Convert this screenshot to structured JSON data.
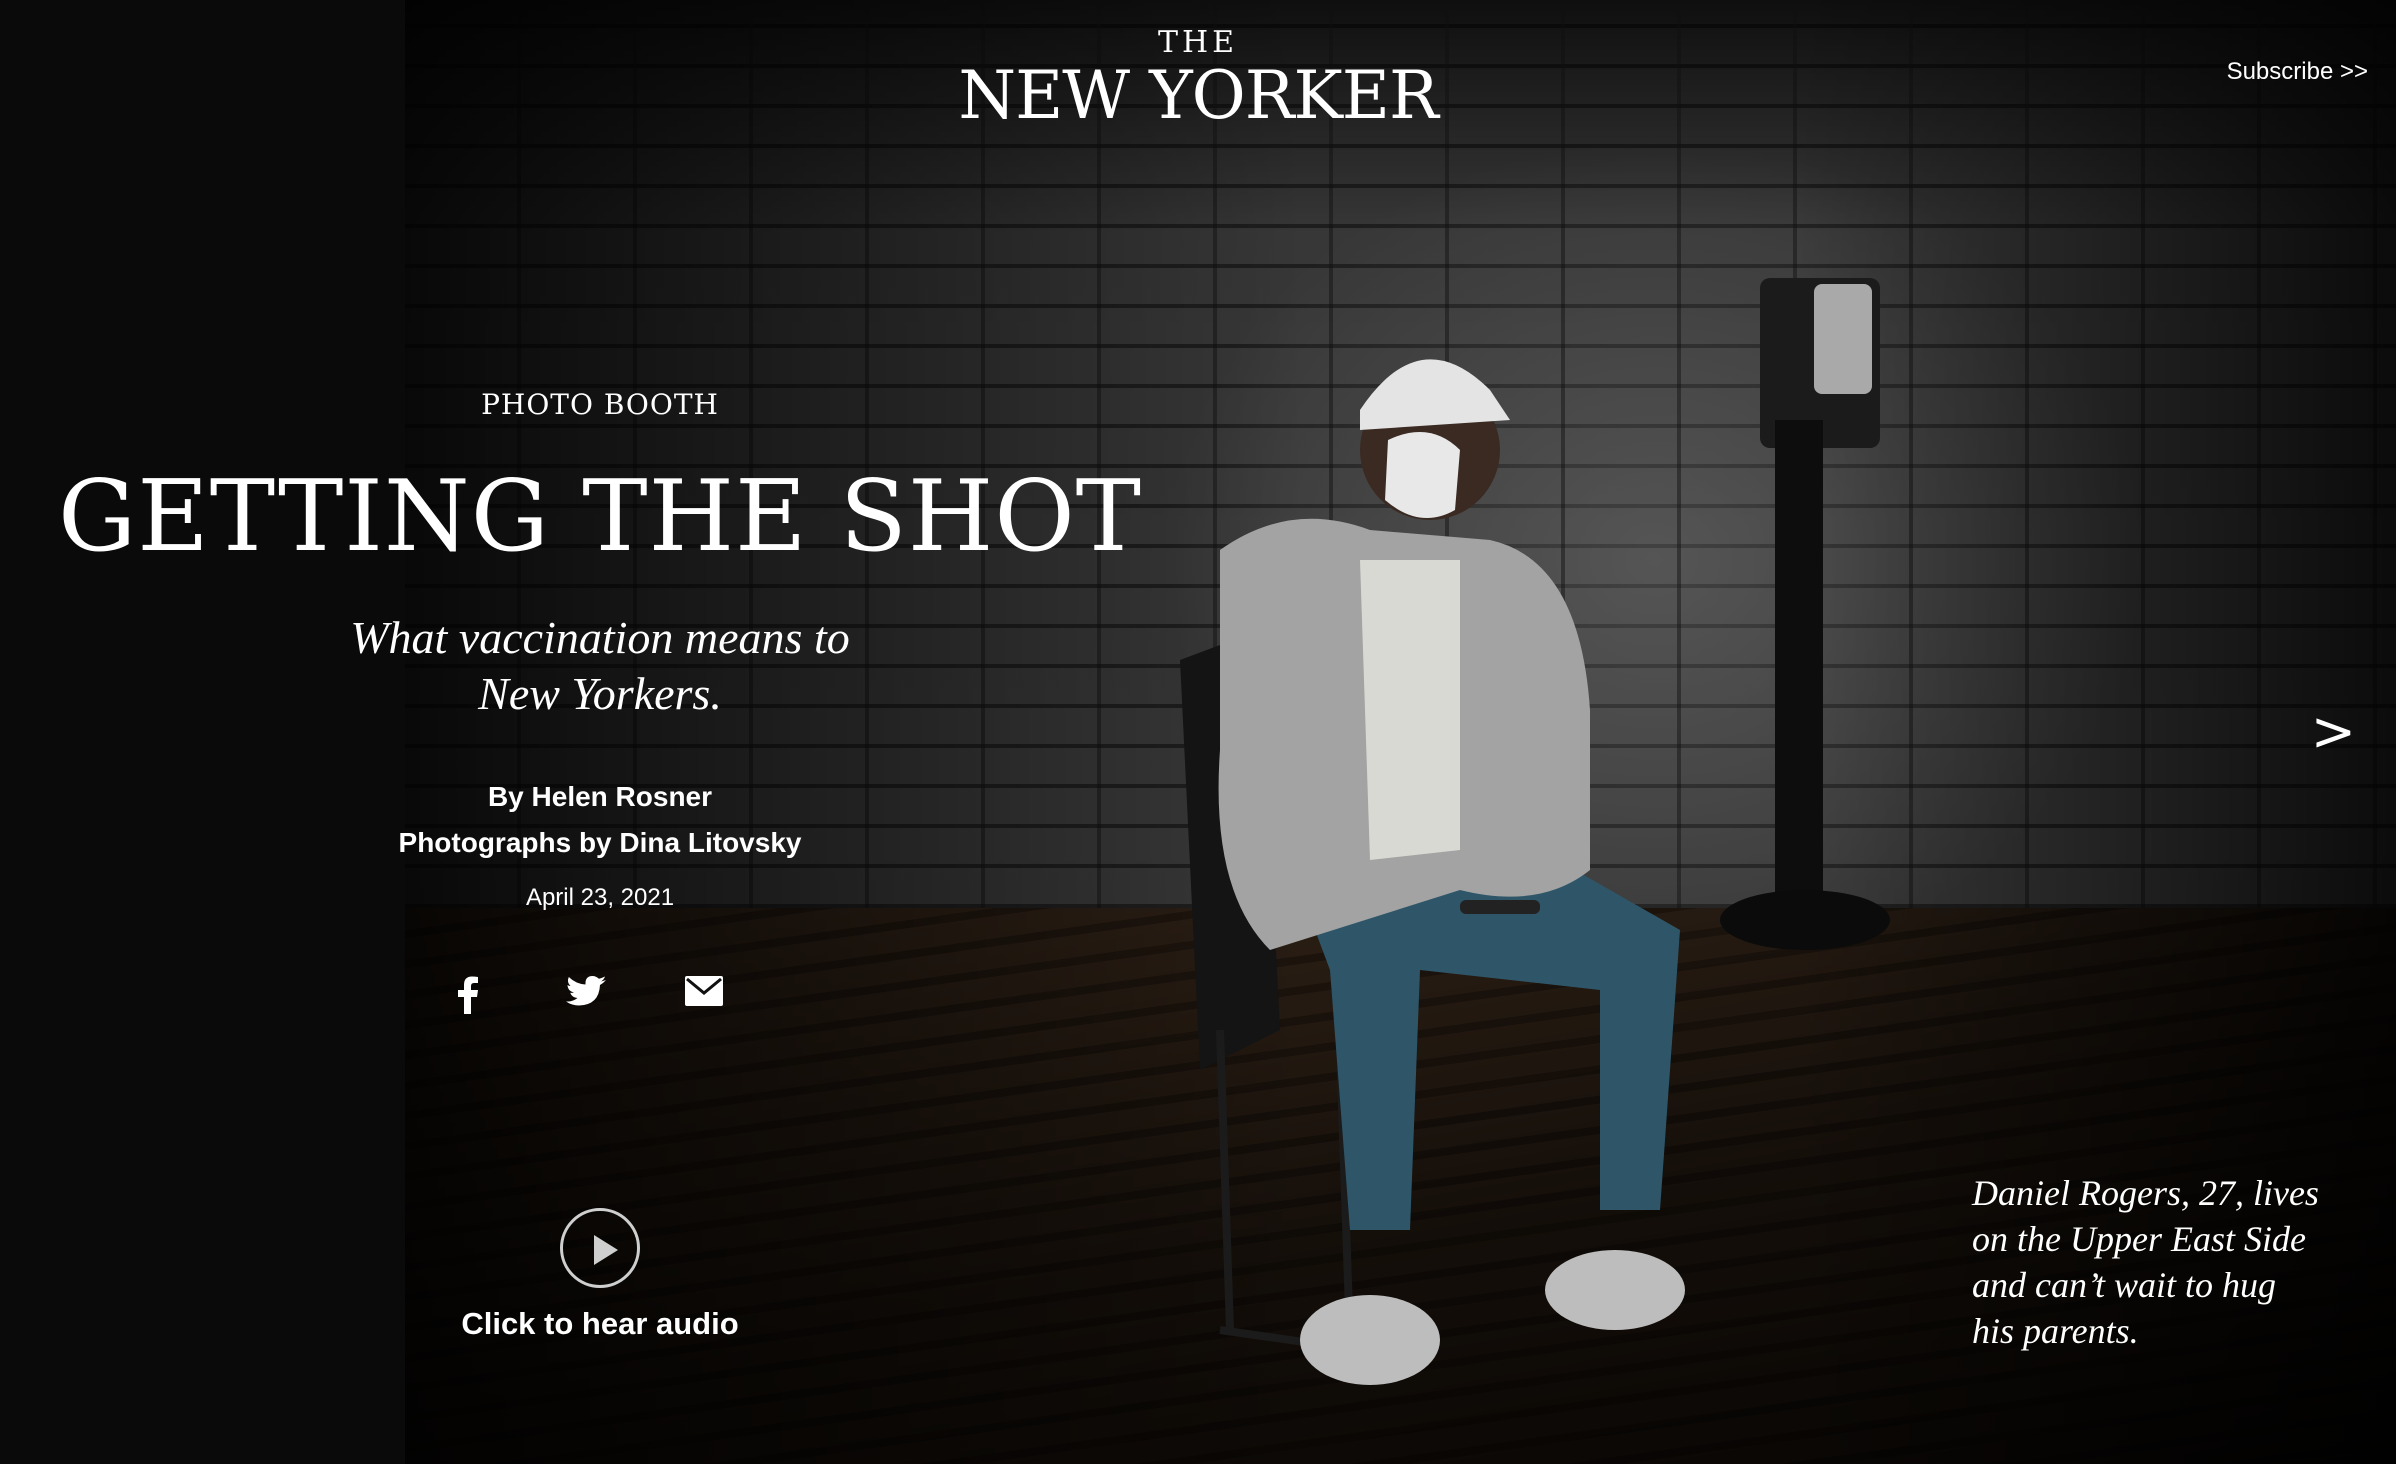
{
  "masthead": {
    "the": "THE",
    "name": "NEW YORKER"
  },
  "header": {
    "subscribe_label": "Subscribe >>"
  },
  "article": {
    "rubric": "PHOTO BOOTH",
    "title": "GETTING THE SHOT",
    "dek_line1": "What vaccination means to",
    "dek_line2": "New Yorkers.",
    "byline": "By Helen Rosner",
    "photo_credit": "Photographs by Dina Litovsky",
    "date": "April 23, 2021"
  },
  "share": {
    "icons": [
      "facebook-icon",
      "twitter-icon",
      "email-icon"
    ]
  },
  "audio": {
    "label": "Click to hear audio"
  },
  "gallery": {
    "next_label": ">",
    "caption_line1": "Daniel Rogers, 27, lives",
    "caption_line2": "on the Upper East Side",
    "caption_line3": "and can’t wait to hug",
    "caption_line4": "his parents."
  }
}
